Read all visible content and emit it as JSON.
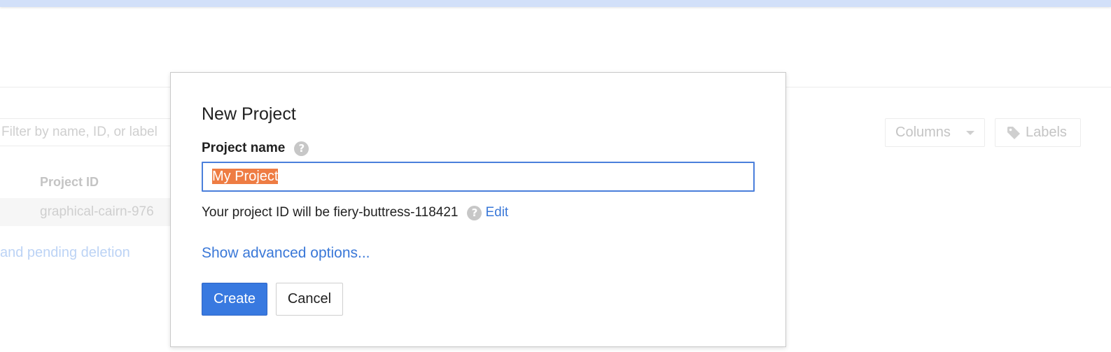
{
  "background": {
    "filter_placeholder": "Filter by name, ID, or label",
    "column_header": "Project ID",
    "row_project_id": "graphical-cairn-976",
    "pending_link": "and pending deletion",
    "columns_button": "Columns",
    "labels_button": "Labels"
  },
  "dialog": {
    "title": "New Project",
    "field_label": "Project name",
    "input_value": "My Project",
    "project_id_text": "Your project ID will be fiery-buttress-118421",
    "edit_link": "Edit",
    "advanced_link": "Show advanced options...",
    "create_button": "Create",
    "cancel_button": "Cancel"
  },
  "icons": {
    "help": "?",
    "tag": "tag-icon",
    "caret": "chevron-down-icon"
  },
  "colors": {
    "accent_blue": "#3879e0",
    "link_blue": "#3a78d8",
    "selection": "#ee7c43",
    "topbar": "#d2e0f9"
  }
}
